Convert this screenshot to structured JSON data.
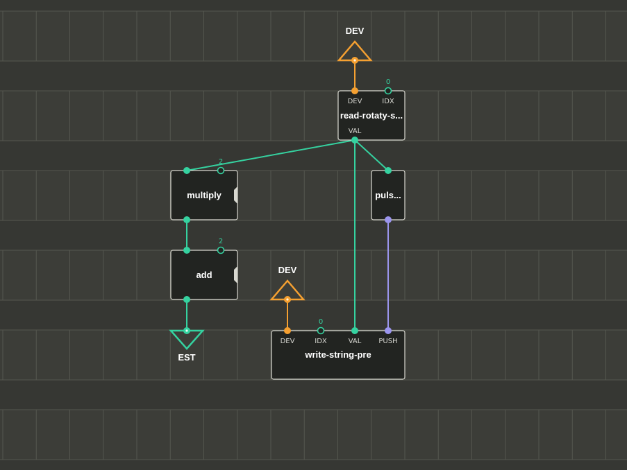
{
  "colors": {
    "background": "#3c3d38",
    "grid_light": "#55574f",
    "grid_dark": "#2f302c",
    "node_fill": "#222421",
    "node_stroke": "#d8d8d0",
    "link_green": "#35d2a0",
    "link_orange": "#f5a031",
    "link_purple": "#9b95ee"
  },
  "terminals": {
    "dev_top": {
      "label": "DEV"
    },
    "dev_bottom": {
      "label": "DEV"
    },
    "est": {
      "label": "EST"
    }
  },
  "nodes": {
    "read": {
      "title": "read-rotaty-s...",
      "pins": {
        "dev": "DEV",
        "idx": "IDX",
        "idx_value": "0",
        "val": "VAL"
      }
    },
    "multiply": {
      "title": "multiply",
      "pins": {
        "in2_value": "2"
      }
    },
    "add": {
      "title": "add",
      "pins": {
        "in2_value": "2"
      }
    },
    "pulse": {
      "title": "puls..."
    },
    "write": {
      "title": "write-string-pre",
      "pins": {
        "dev": "DEV",
        "idx": "IDX",
        "idx_value": "0",
        "val": "VAL",
        "push": "PUSH"
      }
    }
  }
}
